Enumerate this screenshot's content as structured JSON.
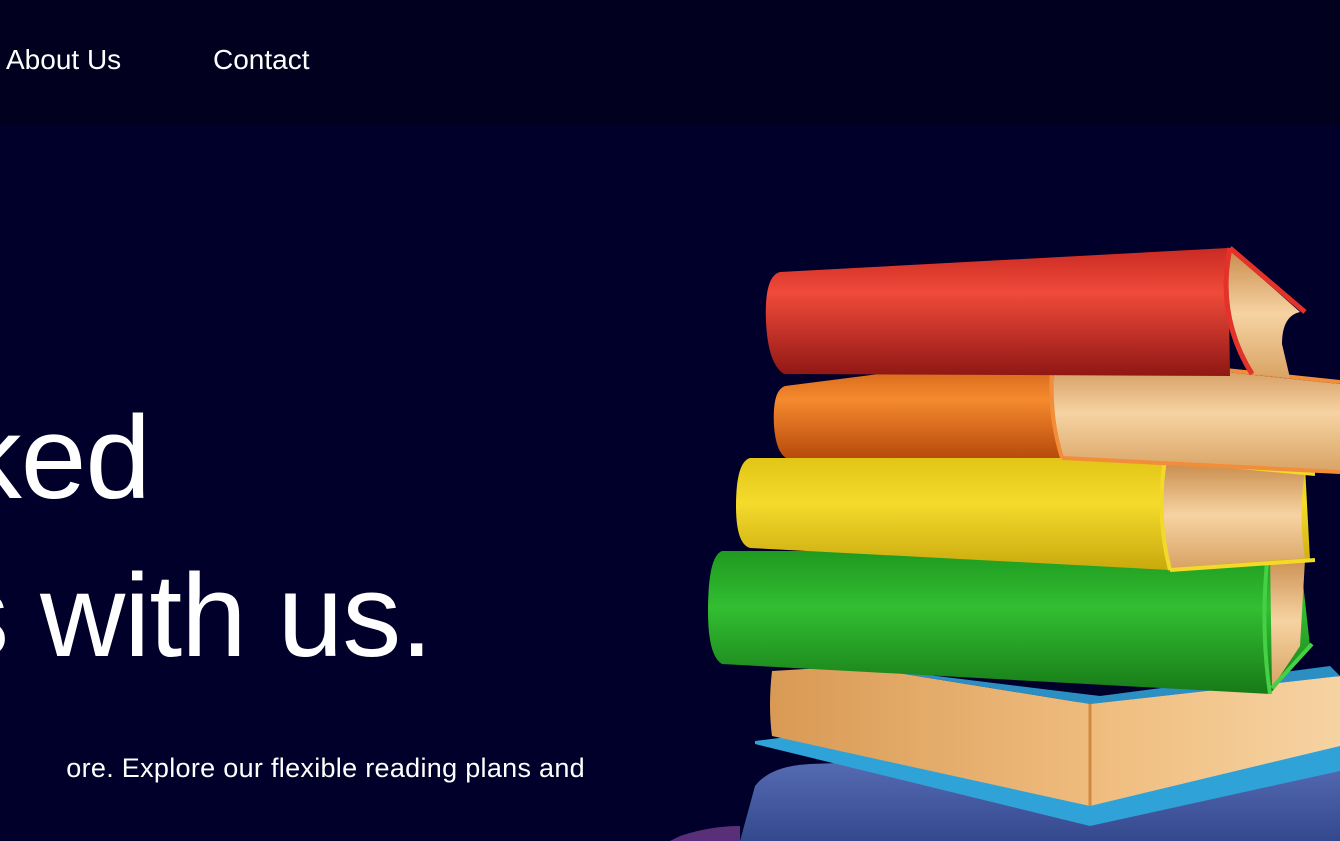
{
  "nav": {
    "items": [
      {
        "label": "About Us"
      },
      {
        "label": "Contact"
      }
    ]
  },
  "hero": {
    "headline_line1": "ked",
    "headline_line2": "s with us.",
    "subtext": "ore. Explore our flexible reading plans and"
  },
  "illustration": {
    "icon": "stacked-books-illustration",
    "colors": {
      "red": "#e03a2c",
      "orange": "#ee7a25",
      "yellow": "#ecd11e",
      "green": "#2aa32a",
      "blue": "#2fa3d8",
      "pages": "#f1c88e",
      "navy": "#4a5fa8"
    }
  }
}
